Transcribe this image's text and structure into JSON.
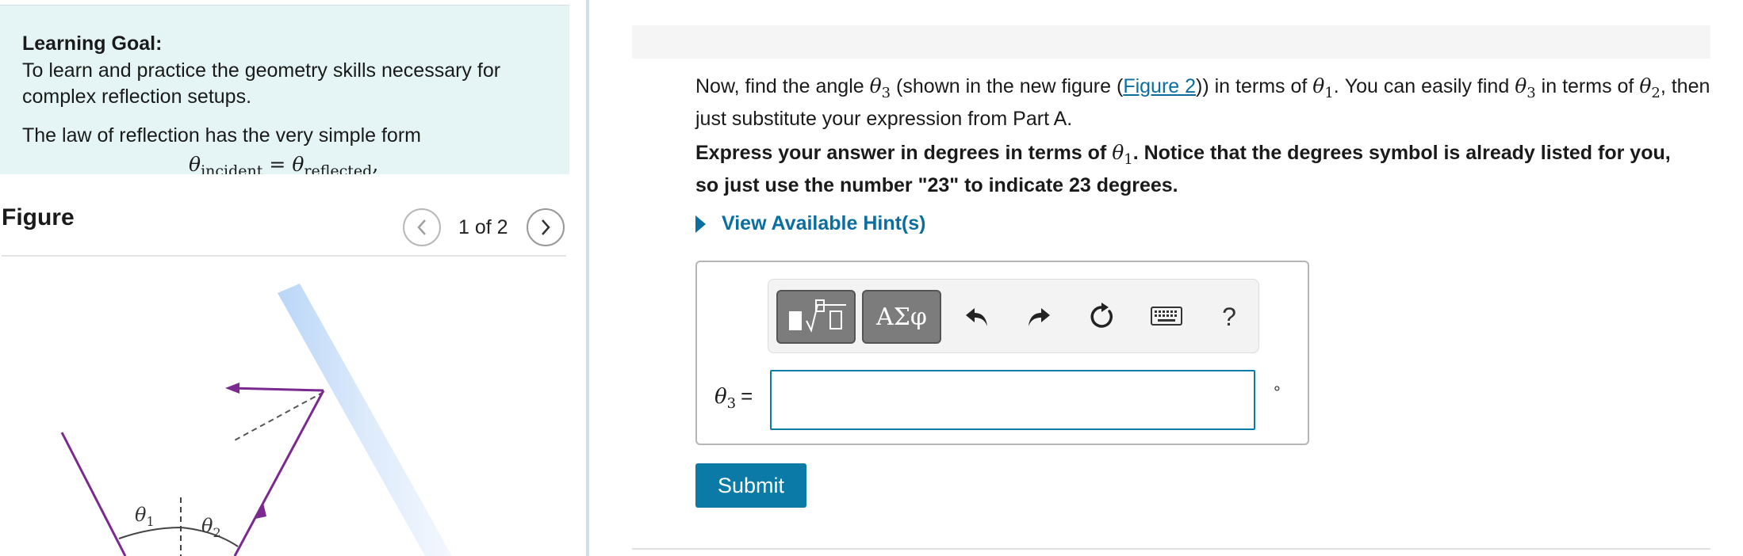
{
  "learning_goal": {
    "title": "Learning Goal:",
    "text": "To learn and practice the geometry skills necessary for complex reflection setups.",
    "law_intro": "The law of reflection has the very simple form",
    "law_formula": {
      "left_var": "θ",
      "left_sub": "incident",
      "equals": "=",
      "right_var": "θ",
      "right_sub": "reflected",
      "trailing": ","
    }
  },
  "figure": {
    "label": "Figure",
    "page_indicator": "1 of 2",
    "prev_icon": "chevron-left-icon",
    "next_icon": "chevron-right-icon",
    "labels": {
      "theta1": "θ1",
      "theta2": "θ2"
    }
  },
  "question": {
    "part1": "Now, find the angle ",
    "theta3_var": "θ",
    "theta3_sub": "3",
    "part2": " (shown in the new figure (",
    "link": "Figure 2",
    "part3": ")) in terms of ",
    "theta1_var": "θ",
    "theta1_sub": "1",
    "part4": ". You can easily find ",
    "theta3b_var": "θ",
    "theta3b_sub": "3",
    "part5": " in terms of ",
    "theta2_var": "θ",
    "theta2_sub": "2",
    "part6": ", then just substitute your expression from Part A."
  },
  "instruction": {
    "part1": "Express your answer in degrees in terms of ",
    "theta1_var": "θ",
    "theta1_sub": "1",
    "part2": ". Notice that the degrees symbol is already listed for you, so just use the number \"23\" to indicate 23 degrees."
  },
  "hint": {
    "label": "View Available Hint(s)"
  },
  "toolbar": {
    "symbols_label": "ΑΣφ",
    "help_label": "?",
    "icons": [
      "templates-icon",
      "undo-icon",
      "redo-icon",
      "reset-icon",
      "keyboard-icon",
      "help-icon"
    ]
  },
  "answer": {
    "var": "θ",
    "sub": "3",
    "equals": "=",
    "value": "",
    "unit": "°"
  },
  "submit_label": "Submit",
  "colors": {
    "accent": "#0a6ea0",
    "submit_bg": "#0b7aa7",
    "goal_bg": "#e5f5f5",
    "ray": "#7a2a8f"
  }
}
